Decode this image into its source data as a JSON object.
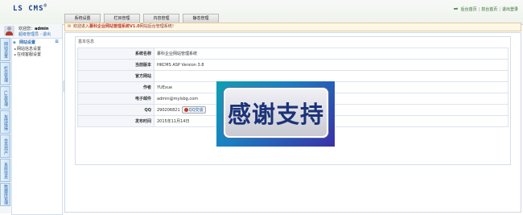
{
  "app": {
    "logo_text": "LS CMS",
    "logo_mark": "®"
  },
  "top_links": {
    "home": "后台首页",
    "site_home": "前台首页",
    "logout": "退出登录",
    "separator": "|"
  },
  "tabs": [
    {
      "label": "系统设置"
    },
    {
      "label": "栏目管理"
    },
    {
      "label": "内容管理"
    },
    {
      "label": "静态管理"
    }
  ],
  "sidebar": {
    "welcome_prefix": "欢迎您：",
    "username": "admin",
    "user_links": "超级管理员 - 退出",
    "vtabs": [
      {
        "label": "网站设置"
      },
      {
        "label": "栏目管理"
      },
      {
        "label": "广告管理"
      },
      {
        "label": "友情链接"
      },
      {
        "label": "会员用户"
      },
      {
        "label": "系统信息"
      },
      {
        "label": "数据库管理"
      }
    ],
    "menu": {
      "title": "网站设置",
      "collapse": "≡",
      "items": [
        {
          "label": "网站信息设置"
        },
        {
          "label": "在线客服设置"
        }
      ]
    }
  },
  "notice": {
    "prefix": "欢迎进入",
    "highlight": "慕科企业网站管理系统V1.0",
    "suffix": "网站后台管理系统！"
  },
  "panel": {
    "title": "基本信息",
    "rows": [
      {
        "label": "系统名称",
        "value": "慕科企业网站管理系统"
      },
      {
        "label": "当前版本",
        "value": "HKCMS ASP Version 3.8"
      },
      {
        "label": "官方网站",
        "value": ""
      },
      {
        "label": "作者",
        "value": "YUExue"
      },
      {
        "label": "电子邮件",
        "value": "admin@mylsbg.com"
      },
      {
        "label": "QQ",
        "value": "290206821",
        "button": "QQ交谈"
      },
      {
        "label": "发布时间",
        "value": "2015年11月14日"
      }
    ]
  },
  "overlay": {
    "text": "感谢支持"
  },
  "colors": {
    "brand": "#1c3f8c",
    "link": "#2a6db3",
    "notice_highlight": "#c0392b",
    "overlay_text": "#1a3278"
  },
  "icons": [
    "home-icon",
    "bell-icon",
    "qq-penguin-icon",
    "arrow-icon"
  ]
}
